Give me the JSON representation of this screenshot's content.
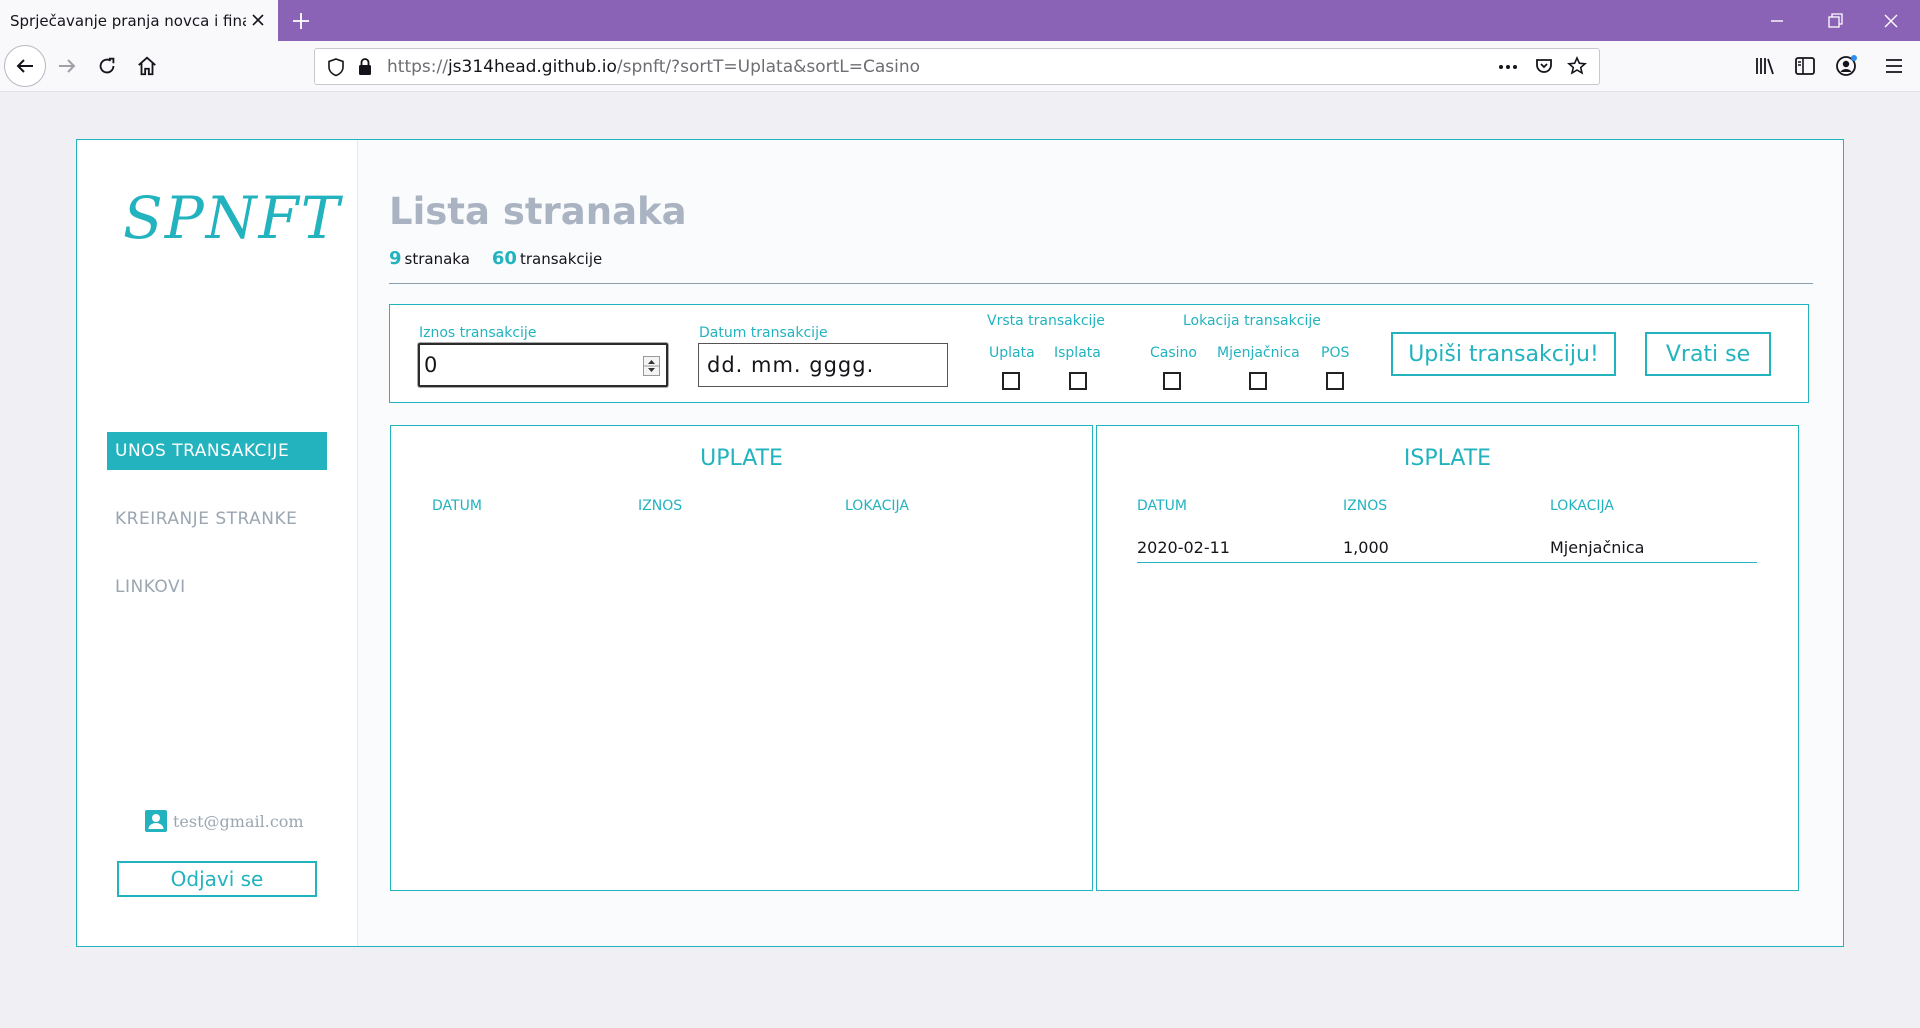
{
  "browser": {
    "tab_title": "Sprječavanje pranja novca i financiranja terorizma",
    "url_prefix": "https://",
    "url_host": "js314head.github.io",
    "url_path": "/spnft/?sortT=Uplata&sortL=Casino"
  },
  "sidebar": {
    "logo": "SPNFT",
    "items": [
      {
        "label": "UNOS TRANSAKCIJE",
        "active": true
      },
      {
        "label": "KREIRANJE STRANKE",
        "active": false
      },
      {
        "label": "LINKOVI",
        "active": false
      }
    ],
    "user_email": "test@gmail.com",
    "logout_label": "Odjavi se"
  },
  "main": {
    "title": "Lista stranaka",
    "stats": {
      "clients_count": "9",
      "clients_label": "stranaka",
      "transactions_count": "60",
      "transactions_label": "transakcije"
    },
    "form": {
      "amount_label": "Iznos transakcije",
      "amount_value": "0",
      "date_label": "Datum transakcije",
      "date_placeholder": "dd. mm. gggg.",
      "type_label": "Vrsta transakcije",
      "type_options": [
        "Uplata",
        "Isplata"
      ],
      "location_label": "Lokacija transakcije",
      "location_options": [
        "Casino",
        "Mjenjačnica",
        "POS"
      ],
      "submit_label": "Upiši transakciju!",
      "back_label": "Vrati se"
    },
    "deposits": {
      "title": "UPLATE",
      "columns": [
        "DATUM",
        "IZNOS",
        "LOKACIJA"
      ],
      "rows": []
    },
    "withdrawals": {
      "title": "ISPLATE",
      "columns": [
        "DATUM",
        "IZNOS",
        "LOKACIJA"
      ],
      "rows": [
        {
          "date": "2020-02-11",
          "amount": "1,000",
          "location": "Mjenjačnica"
        }
      ]
    }
  },
  "colors": {
    "accent": "#22b3bf",
    "titlebar": "#8a63b6",
    "muted": "#9aa6b2"
  }
}
